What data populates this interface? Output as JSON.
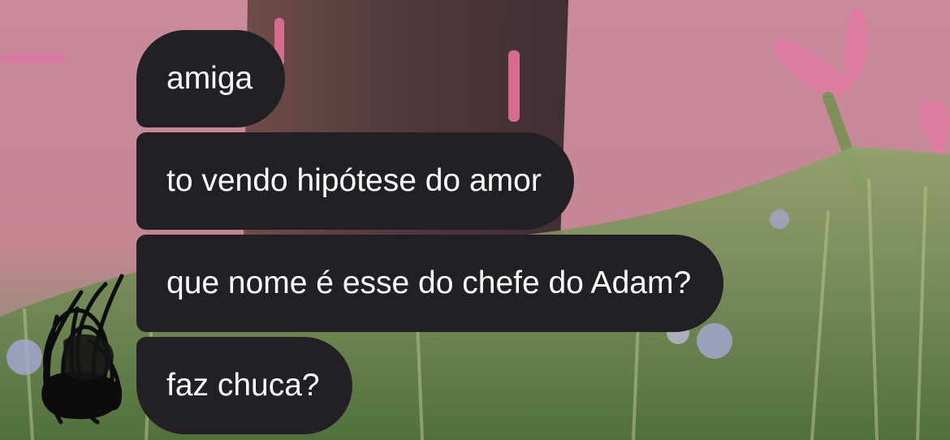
{
  "chat": {
    "messages": [
      {
        "text": "amiga"
      },
      {
        "text": "to vendo hipótese do amor"
      },
      {
        "text": "que nome é esse do chefe do Adam?"
      },
      {
        "text": "faz chuca?"
      }
    ]
  },
  "theme": {
    "bubble_color": "#232025",
    "text_color": "#ffffff",
    "background_top": "#c98a9b",
    "background_bottom": "#6c8a52"
  },
  "icons": {
    "avatar": "redacted-avatar-scribble"
  }
}
